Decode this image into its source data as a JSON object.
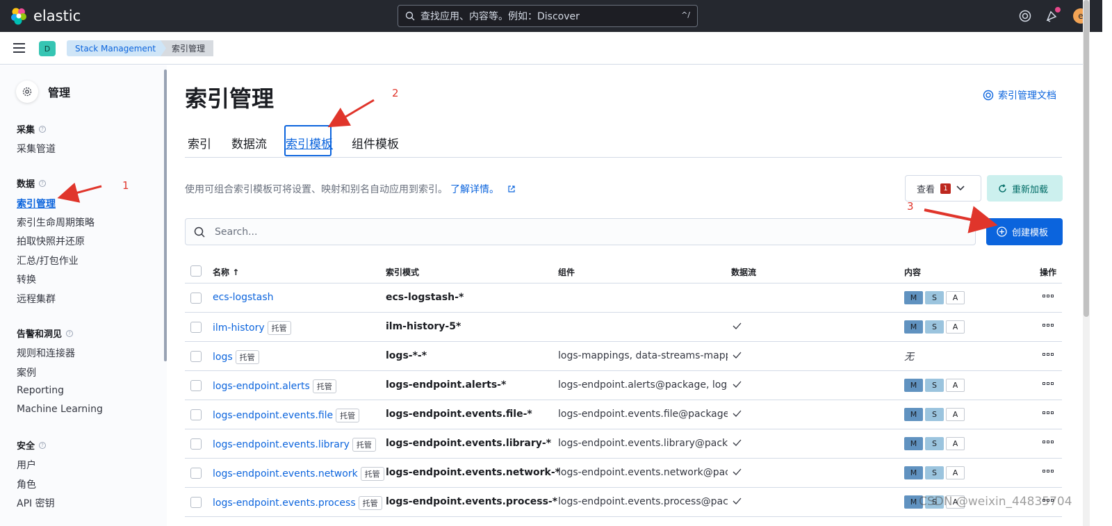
{
  "header": {
    "brand": "elastic",
    "search_placeholder": "查找应用、内容等。例如：Discover",
    "search_shortcut": "^/",
    "user_initial": "e"
  },
  "breadcrumbs": {
    "space": "D",
    "items": [
      "Stack Management",
      "索引管理"
    ]
  },
  "sidebar": {
    "title": "管理",
    "groups": [
      {
        "label": "采集",
        "items": [
          "采集管道"
        ]
      },
      {
        "label": "数据",
        "items": [
          "索引管理",
          "索引生命周期策略",
          "拍取快照并还原",
          "汇总/打包作业",
          "转换",
          "远程集群"
        ]
      },
      {
        "label": "告警和洞见",
        "items": [
          "规则和连接器",
          "案例",
          "Reporting",
          "Machine Learning"
        ]
      },
      {
        "label": "安全",
        "items": [
          "用户",
          "角色",
          "API 密钥"
        ]
      }
    ]
  },
  "annotations": [
    "1",
    "2",
    "3"
  ],
  "main": {
    "title": "索引管理",
    "doc_link": "索引管理文档",
    "tabs": [
      "索引",
      "数据流",
      "索引模板",
      "组件模板"
    ],
    "description": "使用可组合索引模板可将设置、映射和别名自动应用到索引。",
    "learn_more": "了解详情。",
    "view_label": "查看",
    "view_count": "1",
    "reload_label": "重新加载",
    "create_label": "创建模板",
    "table_search_placeholder": "Search..."
  },
  "table": {
    "columns": [
      "名称",
      "索引模式",
      "组件",
      "数据流",
      "内容",
      "操作"
    ],
    "managed_label": "托管",
    "none_label": "无",
    "rows": [
      {
        "name": "ecs-logstash",
        "managed": false,
        "pattern": "ecs-logstash-*",
        "components": "",
        "datastream": false,
        "content": [
          "M",
          "S",
          "A"
        ]
      },
      {
        "name": "ilm-history",
        "managed": true,
        "pattern": "ilm-history-5*",
        "components": "",
        "datastream": true,
        "content": [
          "M",
          "S",
          "A"
        ]
      },
      {
        "name": "logs",
        "managed": true,
        "pattern": "logs-*-*",
        "components": "logs-mappings, data-streams-mappir",
        "datastream": true,
        "content": []
      },
      {
        "name": "logs-endpoint.alerts",
        "managed": true,
        "pattern": "logs-endpoint.alerts-*",
        "components": "logs-endpoint.alerts@package, logs-",
        "datastream": true,
        "content": [
          "M",
          "S",
          "A"
        ]
      },
      {
        "name": "logs-endpoint.events.file",
        "managed": true,
        "pattern": "logs-endpoint.events.file-*",
        "components": "logs-endpoint.events.file@package, l",
        "datastream": true,
        "content": [
          "M",
          "S",
          "A"
        ]
      },
      {
        "name": "logs-endpoint.events.library",
        "managed": true,
        "pattern": "logs-endpoint.events.library-*",
        "components": "logs-endpoint.events.library@packag",
        "datastream": true,
        "content": [
          "M",
          "S",
          "A"
        ]
      },
      {
        "name": "logs-endpoint.events.network",
        "managed": true,
        "pattern": "logs-endpoint.events.network-*",
        "components": "logs-endpoint.events.network@packa",
        "datastream": true,
        "content": [
          "M",
          "S",
          "A"
        ]
      },
      {
        "name": "logs-endpoint.events.process",
        "managed": true,
        "pattern": "logs-endpoint.events.process-*",
        "components": "logs-endpoint.events.process@packa",
        "datastream": true,
        "content": [
          "M",
          "S",
          "A"
        ]
      }
    ]
  },
  "watermark": "CSDN @weixin_44835704",
  "colors": {
    "accent": "#0b64dd",
    "annotation": "#e0352b",
    "header": "#25282f"
  }
}
